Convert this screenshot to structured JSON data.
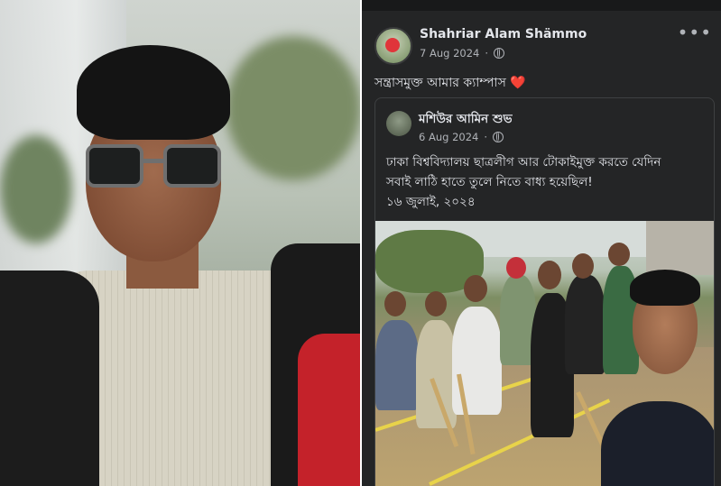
{
  "post": {
    "author": "Shahriar Alam Shämmo",
    "date": "7 Aug 2024",
    "caption": "সন্ত্রাসমুক্ত আমার ক্যাম্পাস",
    "caption_emoji": "❤️",
    "more_label": "•••",
    "privacy_icon": "globe-icon"
  },
  "shared_post": {
    "author": "মশিউর আমিন শুভ",
    "date": "6 Aug 2024",
    "text_line1": "ঢাকা বিশ্ববিদ্যালয় ছাত্রলীগ আর টোকাইমুক্ত করতে যেদিন",
    "text_line2": "সবাই লাঠি হাতে তুলে নিতে বাধ্য হয়েছিল!",
    "text_line3": "১৬ জুলাই, ২০২৪",
    "privacy_icon": "globe-icon"
  },
  "colors": {
    "fb_background": "#242526",
    "fb_text": "#e4e6eb",
    "fb_secondary": "#b0b3b8",
    "heart": "#f0284a"
  }
}
